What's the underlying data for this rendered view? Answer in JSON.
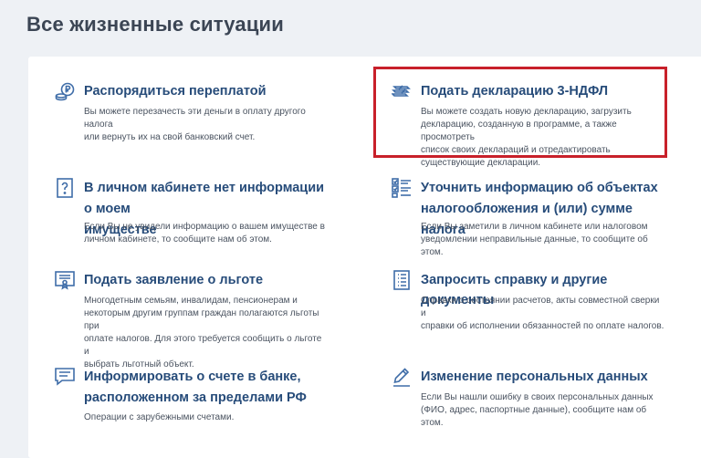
{
  "page": {
    "title": "Все жизненные ситуации"
  },
  "colors": {
    "title": "#274c7a",
    "icon": "#3f6da8",
    "highlight": "#c8202a",
    "background": "#eef1f5"
  },
  "cards": [
    {
      "icon": "coin-ruble-icon",
      "title": "Распорядиться переплатой",
      "desc_lines": [
        "Вы можете перезачесть эти деньги в оплату другого налога",
        "или вернуть их на свой банковский счет."
      ]
    },
    {
      "icon": "declaration-stack-icon",
      "title": "Подать декларацию 3-НДФЛ",
      "desc_lines": [
        "Вы можете создать новую декларацию, загрузить",
        "декларацию, созданную в программе, а также просмотреть",
        "список своих деклараций и отредактировать",
        "существующие декларации."
      ]
    },
    {
      "icon": "question-document-icon",
      "title_lines": [
        "В личном кабинете нет информации о моем",
        "имуществе"
      ],
      "desc_lines": [
        "Если Вы не увидели информацию о вашем имуществе в",
        "личном кабинете, то сообщите нам об этом."
      ]
    },
    {
      "icon": "checklist-icon",
      "title_lines": [
        "Уточнить информацию об объектах",
        "налогообложения и (или) сумме налога"
      ],
      "desc_lines": [
        "Если Вы заметили в личном кабинете или налоговом",
        "уведомлении неправильные данные, то сообщите об этом."
      ]
    },
    {
      "icon": "certificate-icon",
      "title": "Подать заявление о льготе",
      "desc_lines": [
        "Многодетным семьям, инвалидам, пенсионерам и",
        "некоторым другим группам граждан полагаются льготы при",
        "оплате налогов. Для этого требуется сообщить о льготе и",
        "выбрать льготный объект."
      ]
    },
    {
      "icon": "document-list-icon",
      "title": "Запросить справку и другие документы",
      "desc_lines": [
        "Справки о состоянии расчетов, акты совместной сверки и",
        "справки об исполнении обязанностей по оплате налогов."
      ]
    },
    {
      "icon": "message-icon",
      "title_lines": [
        "Информировать о счете в банке,",
        "расположенном за пределами РФ"
      ],
      "desc_lines": [
        "Операции с зарубежными счетами."
      ]
    },
    {
      "icon": "pencil-icon",
      "title": "Изменение персональных данных",
      "desc_lines": [
        "Если Вы нашли ошибку в своих персональных данных",
        "(ФИО, адрес, паспортные данные), сообщите нам об этом."
      ]
    }
  ]
}
